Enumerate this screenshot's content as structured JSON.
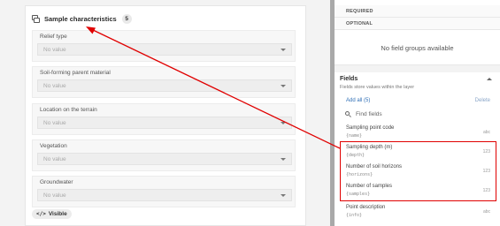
{
  "left": {
    "group": {
      "title": "Sample characteristics",
      "count": "5"
    },
    "fields": [
      {
        "label": "Relief type",
        "placeholder": "No value"
      },
      {
        "label": "Soil-forming parent material",
        "placeholder": "No value"
      },
      {
        "label": "Location on the terrain",
        "placeholder": "No value"
      },
      {
        "label": "Vegetation",
        "placeholder": "No value"
      },
      {
        "label": "Groundwater",
        "placeholder": "No value"
      }
    ],
    "visible": {
      "icon": "</>",
      "label": "Visible"
    }
  },
  "right": {
    "sections": {
      "required": "REQUIRED",
      "optional": "OPTIONAL"
    },
    "empty_message": "No field groups available",
    "fields_title": "Fields",
    "fields_subtitle": "Fields store values within the layer",
    "add_all": "Add all (5)",
    "delete": "Delete",
    "search_placeholder": "Find fields",
    "field_items": [
      {
        "name": "Sampling point code",
        "code": "{name}",
        "type": "abc"
      },
      {
        "name": "Sampling depth (m)",
        "code": "{depth}",
        "type": "123"
      },
      {
        "name": "Number of soil horizons",
        "code": "{horizons}",
        "type": "123"
      },
      {
        "name": "Number of samples",
        "code": "{samples}",
        "type": "123"
      },
      {
        "name": "Point description",
        "code": "{info}",
        "type": "abc"
      }
    ]
  },
  "colors": {
    "annotation": "#e00000",
    "link": "#2f6fb6"
  }
}
